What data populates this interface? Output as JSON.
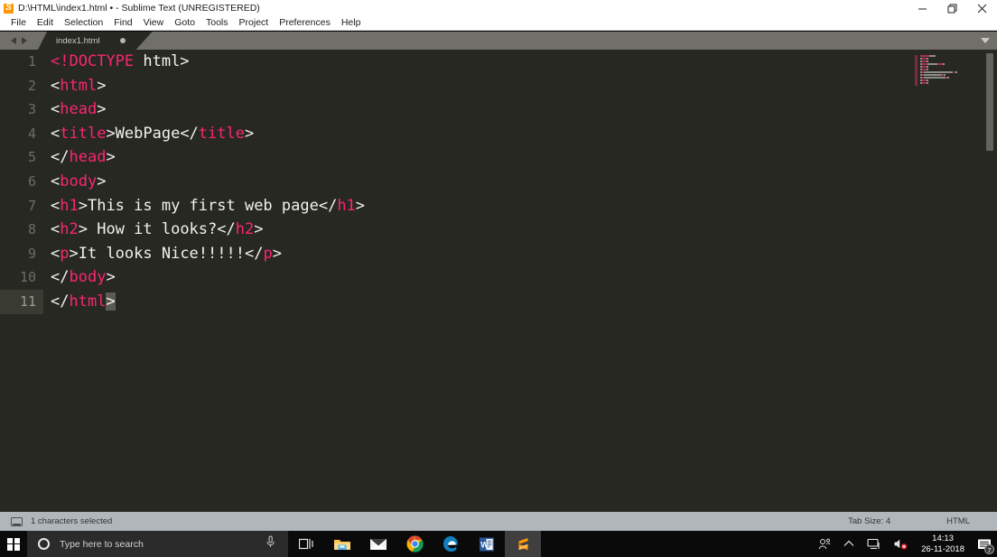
{
  "window": {
    "title": "D:\\HTML\\index1.html • - Sublime Text (UNREGISTERED)",
    "icon": "sublime-text-icon",
    "controls": {
      "minimize": "Minimize",
      "restore": "Restore",
      "close": "Close"
    }
  },
  "menubar": {
    "items": [
      {
        "label": "File"
      },
      {
        "label": "Edit"
      },
      {
        "label": "Selection"
      },
      {
        "label": "Find"
      },
      {
        "label": "View"
      },
      {
        "label": "Goto"
      },
      {
        "label": "Tools"
      },
      {
        "label": "Project"
      },
      {
        "label": "Preferences"
      },
      {
        "label": "Help"
      }
    ]
  },
  "tabs": {
    "open": [
      {
        "label": "index1.html",
        "dirty": true
      }
    ],
    "nav_prev": "previous-tab",
    "nav_next": "next-tab",
    "dropdown": "tab-list-dropdown"
  },
  "editor": {
    "language": "HTML",
    "lines": [
      {
        "num": "1",
        "tokens": [
          {
            "t": "<!DOCTYPE",
            "c": "pnk"
          },
          {
            "t": " html>",
            "c": "wht"
          }
        ]
      },
      {
        "num": "2",
        "tokens": [
          {
            "t": "<",
            "c": "wht"
          },
          {
            "t": "html",
            "c": "pnk"
          },
          {
            "t": ">",
            "c": "wht"
          }
        ]
      },
      {
        "num": "3",
        "tokens": [
          {
            "t": "<",
            "c": "wht"
          },
          {
            "t": "head",
            "c": "pnk"
          },
          {
            "t": ">",
            "c": "wht"
          }
        ]
      },
      {
        "num": "4",
        "tokens": [
          {
            "t": "<",
            "c": "wht"
          },
          {
            "t": "title",
            "c": "pnk"
          },
          {
            "t": ">WebPage</",
            "c": "wht"
          },
          {
            "t": "title",
            "c": "pnk"
          },
          {
            "t": ">",
            "c": "wht"
          }
        ]
      },
      {
        "num": "5",
        "tokens": [
          {
            "t": "</",
            "c": "wht"
          },
          {
            "t": "head",
            "c": "pnk"
          },
          {
            "t": ">",
            "c": "wht"
          }
        ]
      },
      {
        "num": "6",
        "tokens": [
          {
            "t": "<",
            "c": "wht"
          },
          {
            "t": "body",
            "c": "pnk"
          },
          {
            "t": ">",
            "c": "wht"
          }
        ]
      },
      {
        "num": "7",
        "tokens": [
          {
            "t": "<",
            "c": "wht"
          },
          {
            "t": "h1",
            "c": "pnk"
          },
          {
            "t": ">This is my first web page</",
            "c": "wht"
          },
          {
            "t": "h1",
            "c": "pnk"
          },
          {
            "t": ">",
            "c": "wht"
          }
        ]
      },
      {
        "num": "8",
        "tokens": [
          {
            "t": "<",
            "c": "wht"
          },
          {
            "t": "h2",
            "c": "pnk"
          },
          {
            "t": "> How it looks?</",
            "c": "wht"
          },
          {
            "t": "h2",
            "c": "pnk"
          },
          {
            "t": ">",
            "c": "wht"
          }
        ]
      },
      {
        "num": "9",
        "tokens": [
          {
            "t": "<",
            "c": "wht"
          },
          {
            "t": "p",
            "c": "pnk"
          },
          {
            "t": ">It looks Nice!!!!!</",
            "c": "wht"
          },
          {
            "t": "p",
            "c": "pnk"
          },
          {
            "t": ">",
            "c": "wht"
          }
        ]
      },
      {
        "num": "10",
        "tokens": [
          {
            "t": "</",
            "c": "wht"
          },
          {
            "t": "body",
            "c": "pnk"
          },
          {
            "t": ">",
            "c": "wht"
          }
        ]
      },
      {
        "num": "11",
        "active": true,
        "tokens": [
          {
            "t": "</",
            "c": "wht"
          },
          {
            "t": "html",
            "c": "pnk"
          },
          {
            "t": ">",
            "c": "sel"
          }
        ]
      }
    ],
    "colors": {
      "background": "#272822",
      "tag": "#f92672",
      "text": "#f8f8f2",
      "line_number": "#6d6e67",
      "active_line": "#3a3b33",
      "selection": "#5a5b51"
    }
  },
  "statusbar": {
    "selection_info": "1 characters selected",
    "tab_size": "Tab Size: 4",
    "syntax": "HTML"
  },
  "taskbar": {
    "start": "start-button",
    "search_placeholder": "Type here to search",
    "apps": [
      {
        "name": "task-view",
        "label": "Task View"
      },
      {
        "name": "file-explorer",
        "label": "File Explorer"
      },
      {
        "name": "mail",
        "label": "Mail"
      },
      {
        "name": "google-chrome",
        "label": "Google Chrome"
      },
      {
        "name": "microsoft-edge",
        "label": "Microsoft Edge"
      },
      {
        "name": "microsoft-word",
        "label": "Microsoft Word"
      },
      {
        "name": "sublime-text",
        "label": "Sublime Text",
        "active": true
      }
    ],
    "tray": {
      "people": "People",
      "show_hidden": "Show hidden icons",
      "network": "Network",
      "volume": "Volume muted"
    },
    "clock": {
      "time": "14:13",
      "date": "26-11-2018"
    },
    "notifications": {
      "count": "7"
    }
  }
}
